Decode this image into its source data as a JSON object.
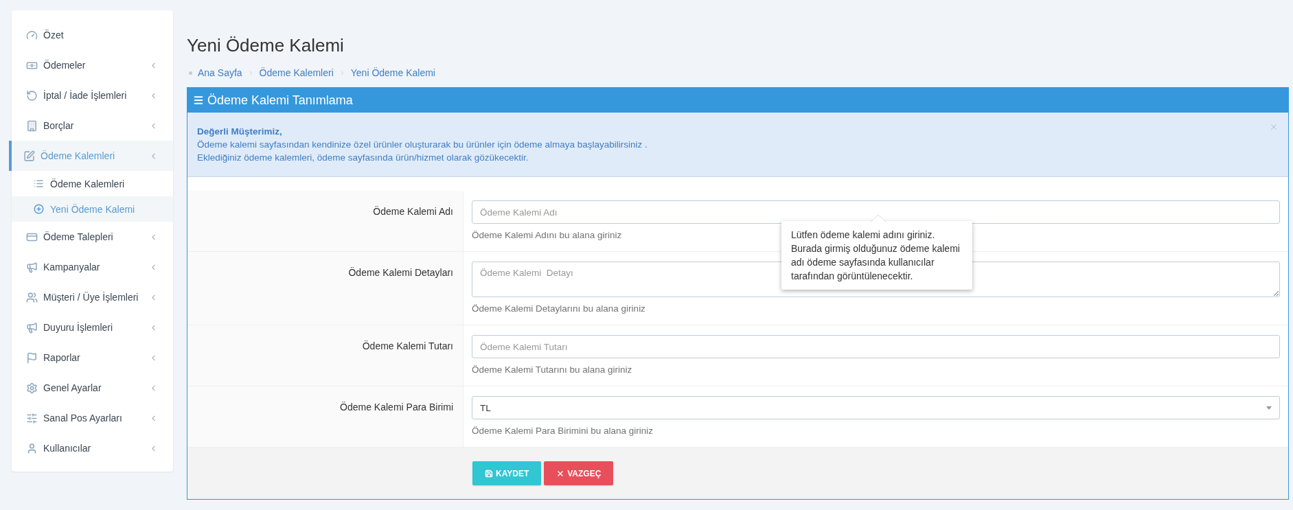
{
  "sidebar": {
    "items": [
      {
        "label": "Özet",
        "submenu": false,
        "selected": false
      },
      {
        "label": "Ödemeler",
        "submenu": true,
        "selected": false
      },
      {
        "label": "İptal / İade İşlemleri",
        "submenu": true,
        "selected": false
      },
      {
        "label": "Borçlar",
        "submenu": true,
        "selected": false
      },
      {
        "label": "Ödeme Kalemleri",
        "submenu": true,
        "selected": true,
        "children": [
          {
            "label": "Ödeme Kalemleri",
            "selected": false
          },
          {
            "label": "Yeni Ödeme Kalemi",
            "selected": true
          }
        ]
      },
      {
        "label": "Ödeme Talepleri",
        "submenu": true,
        "selected": false
      },
      {
        "label": "Kampanyalar",
        "submenu": true,
        "selected": false
      },
      {
        "label": "Müşteri / Üye İşlemleri",
        "submenu": true,
        "selected": false
      },
      {
        "label": "Duyuru İşlemleri",
        "submenu": true,
        "selected": false
      },
      {
        "label": "Raporlar",
        "submenu": true,
        "selected": false
      },
      {
        "label": "Genel Ayarlar",
        "submenu": true,
        "selected": false
      },
      {
        "label": "Sanal Pos Ayarları",
        "submenu": true,
        "selected": false
      },
      {
        "label": "Kullanıcılar",
        "submenu": true,
        "selected": false
      }
    ]
  },
  "page": {
    "title": "Yeni Ödeme Kalemi",
    "breadcrumb": [
      "Ana Sayfa",
      "Ödeme Kalemleri",
      "Yeni Ödeme Kalemi"
    ]
  },
  "panel": {
    "title": "Ödeme Kalemi Tanımlama",
    "alert": {
      "title": "Değerli Müşterimiz,",
      "lines": [
        "Ödeme kalemi sayfasından kendinize özel ürünler oluşturarak bu ürünler için ödeme almaya başlayabilirsiniz .",
        "Eklediğiniz ödeme kalemleri, ödeme sayfasında ürün/hizmet olarak gözükecektir."
      ]
    },
    "fields": [
      {
        "kind": "input",
        "label": "Ödeme Kalemi Adı",
        "placeholder": "Ödeme Kalemi Adı",
        "help": "Ödeme Kalemi Adını bu alana giriniz"
      },
      {
        "kind": "textarea",
        "label": "Ödeme Kalemi Detayları",
        "placeholder": "Ödeme Kalemi  Detayı",
        "help": "Ödeme Kalemi Detaylarını bu alana giriniz"
      },
      {
        "kind": "input",
        "label": "Ödeme Kalemi Tutarı",
        "placeholder": "Ödeme Kalemi Tutarı",
        "help": "Ödeme Kalemi Tutarını bu alana giriniz"
      },
      {
        "kind": "select",
        "label": "Ödeme Kalemi Para Birimi",
        "value": "TL",
        "help": "Ödeme Kalemi Para Birimini bu alana giriniz"
      }
    ],
    "tooltip": "Lütfen ödeme kalemi adını giriniz. Burada girmiş olduğunuz ödeme kalemi adı ödeme sayfasında kullanıcılar tarafından görüntülenecektir.",
    "buttons": [
      {
        "kind": "save",
        "label": "KAYDET"
      },
      {
        "kind": "cancel",
        "label": "VAZGEÇ"
      }
    ]
  }
}
